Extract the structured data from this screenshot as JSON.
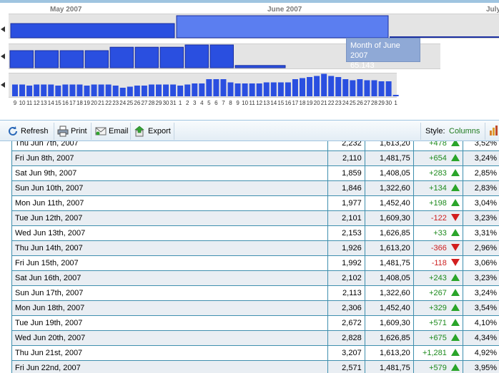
{
  "timeline": {
    "months": [
      {
        "label": "May 2007"
      },
      {
        "label": "June 2007"
      },
      {
        "label": "July"
      }
    ],
    "tooltip": {
      "title": "Month of June 2007",
      "value": "65.143"
    },
    "day_labels": [
      "9",
      "10",
      "11",
      "12",
      "13",
      "14",
      "15",
      "16",
      "17",
      "18",
      "19",
      "20",
      "21",
      "22",
      "23",
      "24",
      "25",
      "26",
      "27",
      "28",
      "29",
      "30",
      "31",
      "1",
      "2",
      "3",
      "4",
      "5",
      "6",
      "7",
      "8",
      "9",
      "10",
      "11",
      "12",
      "13",
      "14",
      "15",
      "16",
      "17",
      "18",
      "19",
      "20",
      "21",
      "22",
      "23",
      "24",
      "25",
      "26",
      "27",
      "28",
      "29",
      "30",
      "1"
    ],
    "daily_levels": [
      0.55,
      0.55,
      0.5,
      0.55,
      0.55,
      0.55,
      0.5,
      0.55,
      0.55,
      0.55,
      0.5,
      0.55,
      0.55,
      0.55,
      0.5,
      0.4,
      0.45,
      0.5,
      0.5,
      0.55,
      0.55,
      0.55,
      0.55,
      0.5,
      0.55,
      0.6,
      0.6,
      0.8,
      0.8,
      0.8,
      0.65,
      0.6,
      0.6,
      0.6,
      0.6,
      0.65,
      0.65,
      0.65,
      0.65,
      0.8,
      0.85,
      0.9,
      0.95,
      1.05,
      0.95,
      0.9,
      0.8,
      0.75,
      0.8,
      0.75,
      0.75,
      0.7,
      0.7,
      0.06
    ],
    "week_levels": [
      0.75,
      0.75,
      0.75,
      0.75,
      0.9,
      0.9,
      0.9,
      1.0,
      1.0,
      0.1
    ]
  },
  "toolbar": {
    "refresh": "Refresh",
    "print": "Print",
    "email": "Email",
    "export": "Export",
    "style_label": "Style:",
    "style_value": "Columns"
  },
  "table": {
    "rows": [
      {
        "date": "Thu Jun 7th, 2007",
        "a": "2,232",
        "b": "1,613,20",
        "chg": "+478",
        "dir": "up",
        "pct": "3,52%"
      },
      {
        "date": "Fri Jun 8th, 2007",
        "a": "2,110",
        "b": "1,481,75",
        "chg": "+654",
        "dir": "up",
        "pct": "3,24%"
      },
      {
        "date": "Sat Jun 9th, 2007",
        "a": "1,859",
        "b": "1,408,05",
        "chg": "+283",
        "dir": "up",
        "pct": "2,85%"
      },
      {
        "date": "Sun Jun 10th, 2007",
        "a": "1,846",
        "b": "1,322,60",
        "chg": "+134",
        "dir": "up",
        "pct": "2,83%"
      },
      {
        "date": "Mon Jun 11th, 2007",
        "a": "1,977",
        "b": "1,452,40",
        "chg": "+198",
        "dir": "up",
        "pct": "3,04%"
      },
      {
        "date": "Tue Jun 12th, 2007",
        "a": "2,101",
        "b": "1,609,30",
        "chg": "-122",
        "dir": "down",
        "pct": "3,23%"
      },
      {
        "date": "Wed Jun 13th, 2007",
        "a": "2,153",
        "b": "1,626,85",
        "chg": "+33",
        "dir": "up",
        "pct": "3,31%"
      },
      {
        "date": "Thu Jun 14th, 2007",
        "a": "1,926",
        "b": "1,613,20",
        "chg": "-366",
        "dir": "down",
        "pct": "2,96%"
      },
      {
        "date": "Fri Jun 15th, 2007",
        "a": "1,992",
        "b": "1,481,75",
        "chg": "-118",
        "dir": "down",
        "pct": "3,06%"
      },
      {
        "date": "Sat Jun 16th, 2007",
        "a": "2,102",
        "b": "1,408,05",
        "chg": "+243",
        "dir": "up",
        "pct": "3,23%"
      },
      {
        "date": "Sun Jun 17th, 2007",
        "a": "2,113",
        "b": "1,322,60",
        "chg": "+267",
        "dir": "up",
        "pct": "3,24%"
      },
      {
        "date": "Mon Jun 18th, 2007",
        "a": "2,306",
        "b": "1,452,40",
        "chg": "+329",
        "dir": "up",
        "pct": "3,54%"
      },
      {
        "date": "Tue Jun 19th, 2007",
        "a": "2,672",
        "b": "1,609,30",
        "chg": "+571",
        "dir": "up",
        "pct": "4,10%"
      },
      {
        "date": "Wed Jun 20th, 2007",
        "a": "2,828",
        "b": "1,626,85",
        "chg": "+675",
        "dir": "up",
        "pct": "4,34%"
      },
      {
        "date": "Thu Jun 21st, 2007",
        "a": "3,207",
        "b": "1,613,20",
        "chg": "+1,281",
        "dir": "up",
        "pct": "4,92%"
      },
      {
        "date": "Fri Jun 22nd, 2007",
        "a": "2,571",
        "b": "1,481,75",
        "chg": "+579",
        "dir": "up",
        "pct": "3,95%"
      }
    ]
  },
  "colors": {
    "bar_fill": "#2a4fe0",
    "selected_fill": "#5b7ef0",
    "positive": "#1d8a1d",
    "negative": "#cc1f1f",
    "grid_border": "#3f8fae"
  }
}
